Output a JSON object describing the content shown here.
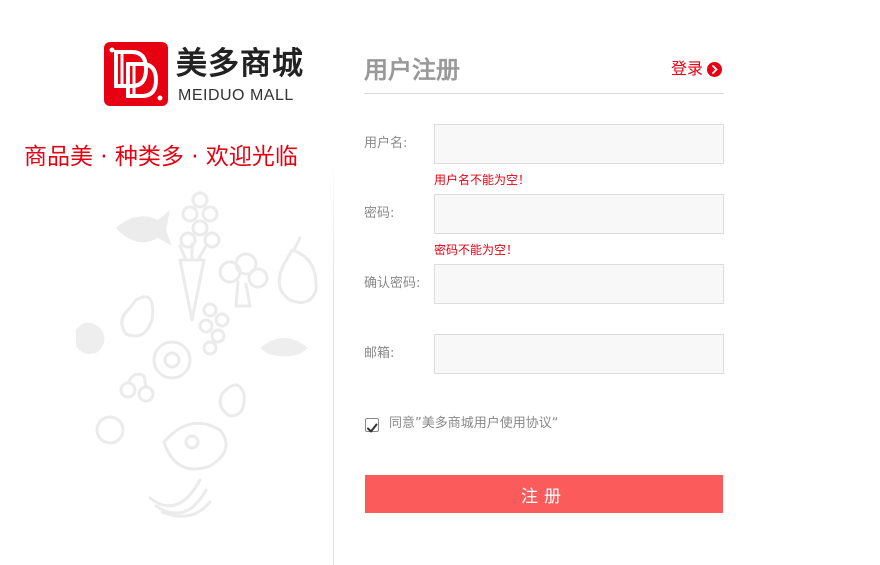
{
  "brand": {
    "name_cn": "美多商城",
    "name_en": "MEIDUO MALL",
    "slogan": "商品美 · 种类多 · 欢迎光临"
  },
  "form": {
    "title": "用户注册",
    "login_link": "登录",
    "fields": [
      {
        "label": "用户名:",
        "value": "",
        "error": "用户名不能为空！"
      },
      {
        "label": "密码:",
        "value": "",
        "error": "密码不能为空！"
      },
      {
        "label": "确认密码:",
        "value": "",
        "error": ""
      },
      {
        "label": "邮箱:",
        "value": "",
        "error": ""
      }
    ],
    "agreement": {
      "checked": true,
      "text": "同意”美多商城用户使用协议“"
    },
    "submit_label": "注册"
  },
  "colors": {
    "brand_red": "#e60012",
    "button": "#fb5b5b",
    "field_bg": "#f8f8f8"
  },
  "icons": [
    "logo-dd",
    "chevron-right-icon",
    "check-icon",
    "fruit-vegetable-doodles"
  ]
}
